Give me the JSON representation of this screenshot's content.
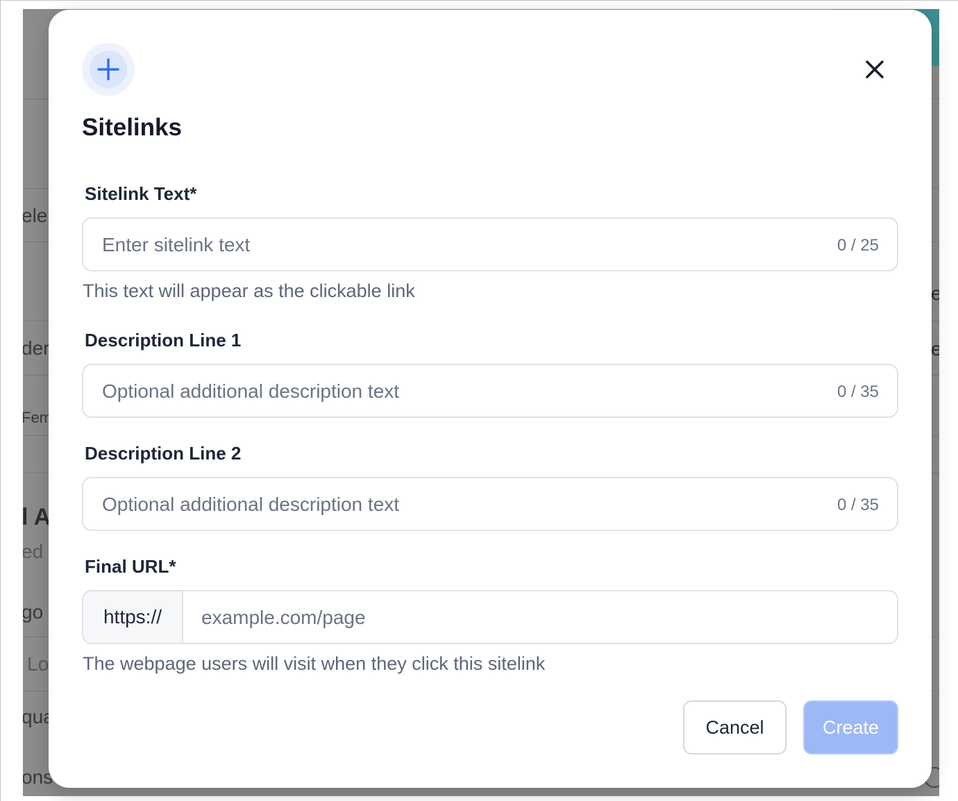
{
  "background": {
    "fragments": [
      "ele",
      "der",
      "Fem",
      "l A",
      "ed",
      "go",
      "Lo",
      "qua",
      "ons"
    ],
    "right_fragments": [
      "e",
      "e"
    ]
  },
  "modal": {
    "header_icon": "plus-icon",
    "title": "Sitelinks",
    "close_icon": "close-icon",
    "fields": {
      "sitelink_text": {
        "label": "Sitelink Text*",
        "placeholder": "Enter sitelink text",
        "counter": "0 / 25",
        "help": "This text will appear as the clickable link"
      },
      "description_line_1": {
        "label": "Description Line 1",
        "placeholder": "Optional additional description text",
        "counter": "0 / 35"
      },
      "description_line_2": {
        "label": "Description Line 2",
        "placeholder": "Optional additional description text",
        "counter": "0 / 35"
      },
      "final_url": {
        "label": "Final URL*",
        "prefix": "https://",
        "placeholder": "example.com/page",
        "help": "The webpage users will visit when they click this sitelink"
      }
    },
    "buttons": {
      "cancel": "Cancel",
      "create": "Create"
    }
  },
  "colors": {
    "accent": "#2f6fed",
    "create_button_disabled": "#9db8f7",
    "backdrop": "#8c8c8c"
  }
}
